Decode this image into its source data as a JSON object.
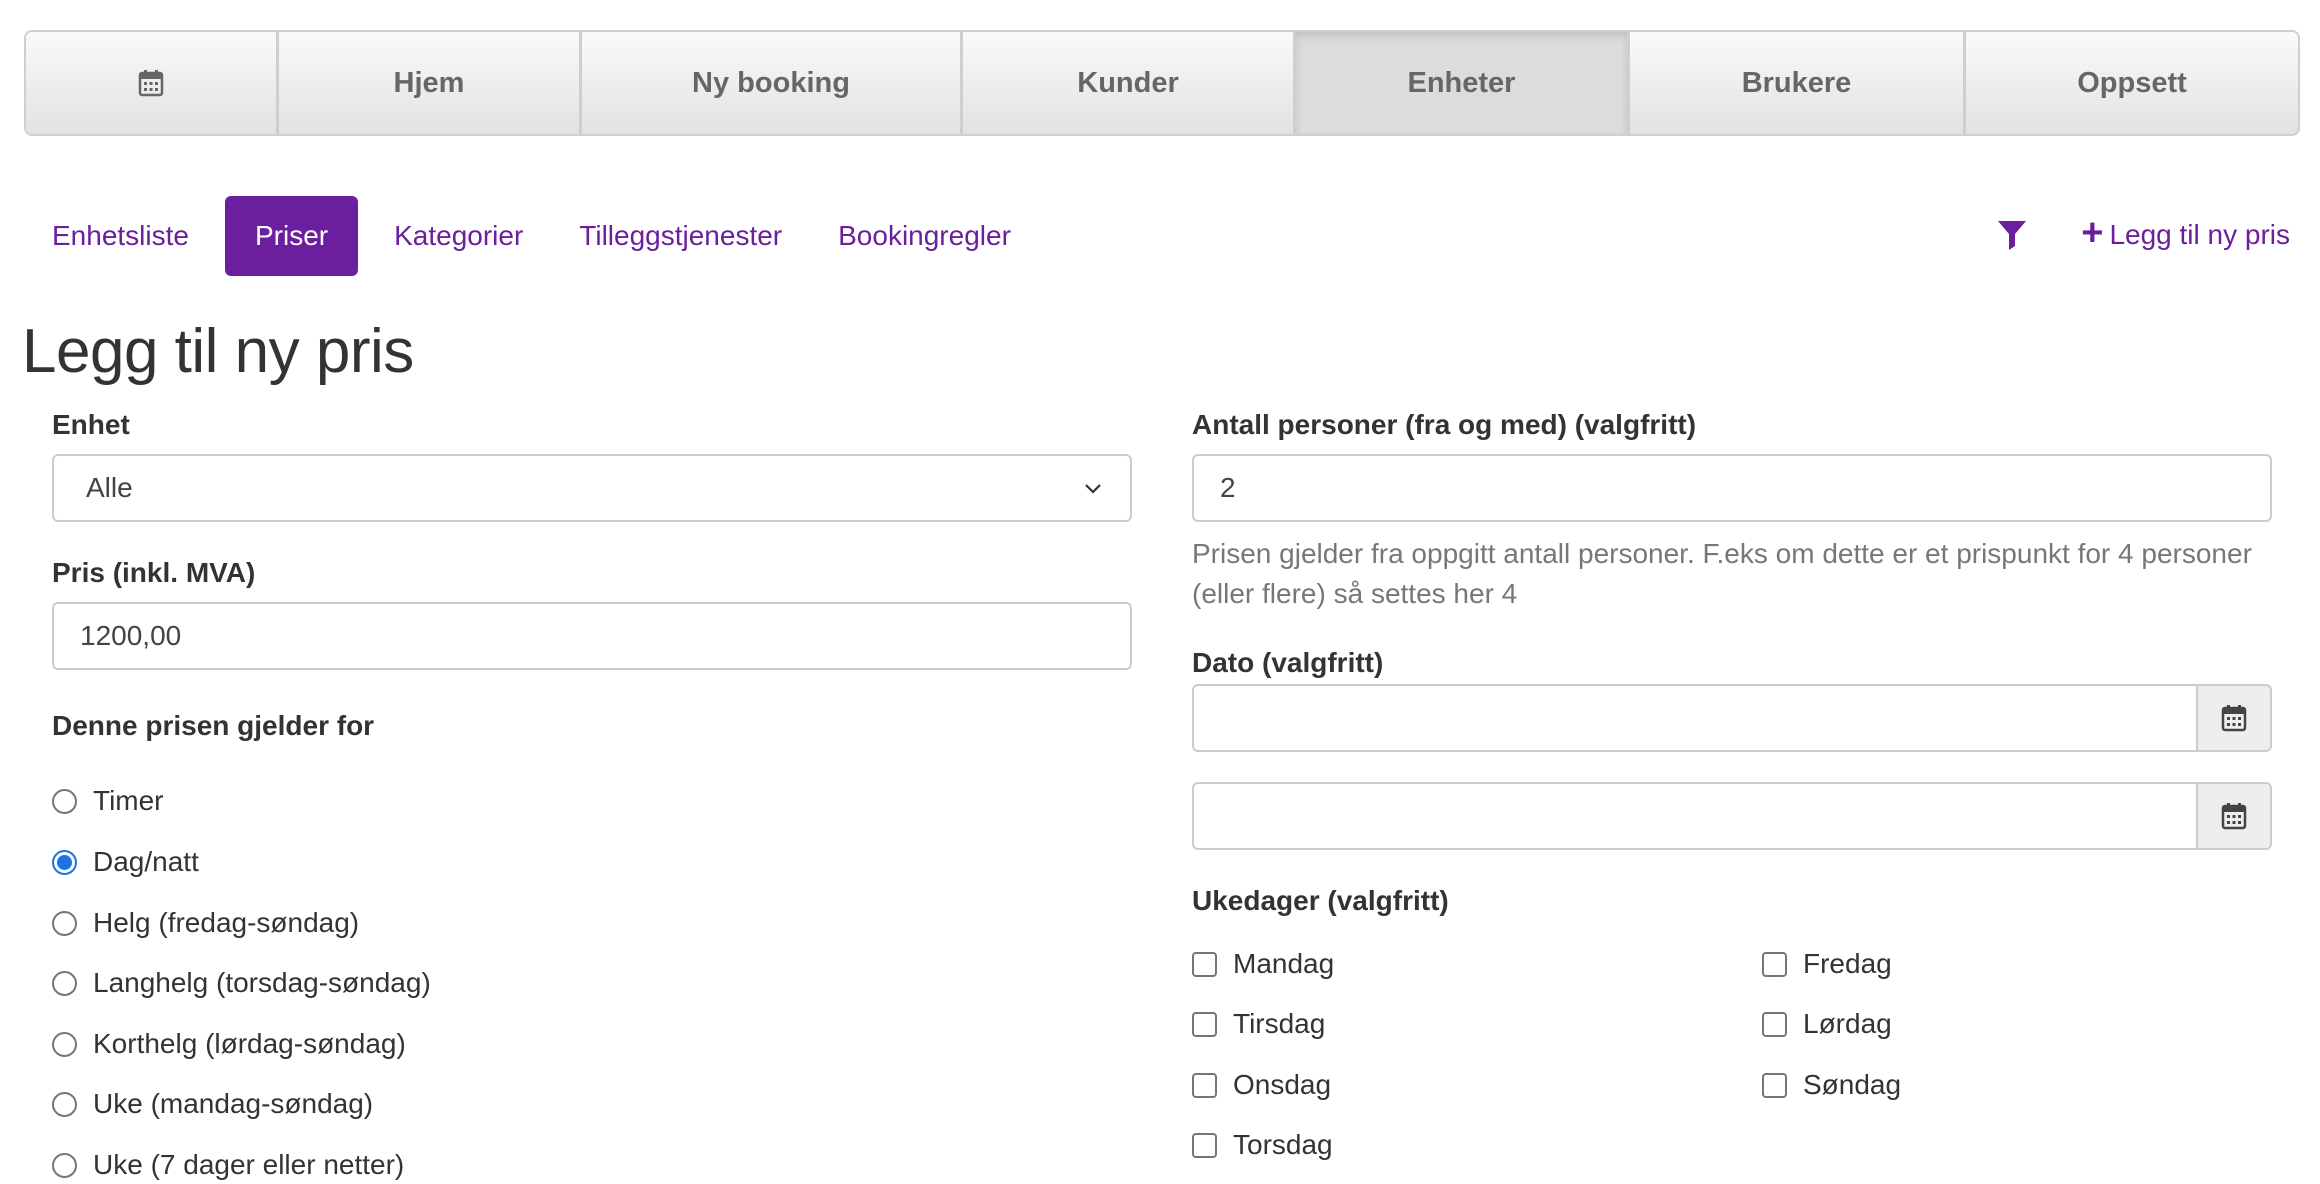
{
  "topnav": {
    "items": [
      {
        "label": "",
        "icon": "calendar-icon"
      },
      {
        "label": "Hjem"
      },
      {
        "label": "Ny booking"
      },
      {
        "label": "Kunder"
      },
      {
        "label": "Enheter",
        "active": true
      },
      {
        "label": "Brukere"
      },
      {
        "label": "Oppsett"
      }
    ]
  },
  "subtabs": {
    "items": [
      {
        "label": "Enhetsliste"
      },
      {
        "label": "Priser",
        "active": true
      },
      {
        "label": "Kategorier"
      },
      {
        "label": "Tilleggstjenester"
      },
      {
        "label": "Bookingregler"
      }
    ],
    "add_label": "Legg til ny pris"
  },
  "page": {
    "title": "Legg til ny pris"
  },
  "form": {
    "unit": {
      "label": "Enhet",
      "value": "Alle"
    },
    "price": {
      "label": "Pris (inkl. MVA)",
      "value": "1200,00"
    },
    "applies_to": {
      "label": "Denne prisen gjelder for",
      "options": [
        "Timer",
        "Dag/natt",
        "Helg (fredag-søndag)",
        "Langhelg (torsdag-søndag)",
        "Korthelg (lørdag-søndag)",
        "Uke (mandag-søndag)",
        "Uke (7 dager eller netter)"
      ],
      "selected": "Dag/natt"
    },
    "persons": {
      "label": "Antall personer (fra og med) (valgfritt)",
      "value": "2",
      "help": "Prisen gjelder fra oppgitt antall personer. F.eks om dette er et prispunkt for 4 personer (eller flere) så settes her 4"
    },
    "date": {
      "label": "Dato (valgfritt)",
      "from_value": "",
      "to_value": ""
    },
    "weekdays": {
      "label": "Ukedager (valgfritt)",
      "left": [
        "Mandag",
        "Tirsdag",
        "Onsdag",
        "Torsdag"
      ],
      "right": [
        "Fredag",
        "Lørdag",
        "Søndag"
      ]
    }
  },
  "colors": {
    "accent": "#6b1f9e",
    "radio_checked": "#1a73e8"
  }
}
